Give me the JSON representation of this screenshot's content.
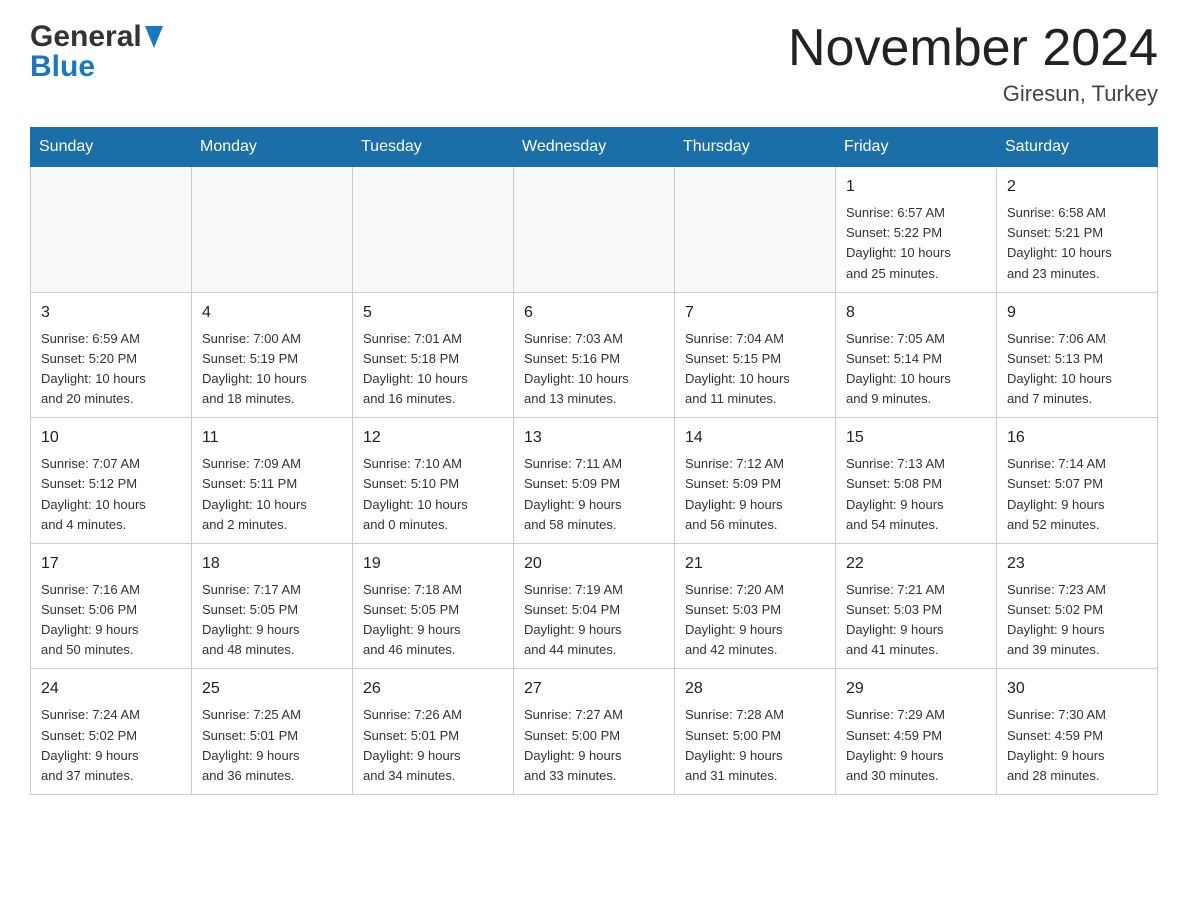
{
  "header": {
    "logo_general": "General",
    "logo_blue": "Blue",
    "month_year": "November 2024",
    "location": "Giresun, Turkey"
  },
  "calendar": {
    "days_of_week": [
      "Sunday",
      "Monday",
      "Tuesday",
      "Wednesday",
      "Thursday",
      "Friday",
      "Saturday"
    ],
    "weeks": [
      {
        "days": [
          {
            "date": "",
            "info": ""
          },
          {
            "date": "",
            "info": ""
          },
          {
            "date": "",
            "info": ""
          },
          {
            "date": "",
            "info": ""
          },
          {
            "date": "",
            "info": ""
          },
          {
            "date": "1",
            "info": "Sunrise: 6:57 AM\nSunset: 5:22 PM\nDaylight: 10 hours\nand 25 minutes."
          },
          {
            "date": "2",
            "info": "Sunrise: 6:58 AM\nSunset: 5:21 PM\nDaylight: 10 hours\nand 23 minutes."
          }
        ]
      },
      {
        "days": [
          {
            "date": "3",
            "info": "Sunrise: 6:59 AM\nSunset: 5:20 PM\nDaylight: 10 hours\nand 20 minutes."
          },
          {
            "date": "4",
            "info": "Sunrise: 7:00 AM\nSunset: 5:19 PM\nDaylight: 10 hours\nand 18 minutes."
          },
          {
            "date": "5",
            "info": "Sunrise: 7:01 AM\nSunset: 5:18 PM\nDaylight: 10 hours\nand 16 minutes."
          },
          {
            "date": "6",
            "info": "Sunrise: 7:03 AM\nSunset: 5:16 PM\nDaylight: 10 hours\nand 13 minutes."
          },
          {
            "date": "7",
            "info": "Sunrise: 7:04 AM\nSunset: 5:15 PM\nDaylight: 10 hours\nand 11 minutes."
          },
          {
            "date": "8",
            "info": "Sunrise: 7:05 AM\nSunset: 5:14 PM\nDaylight: 10 hours\nand 9 minutes."
          },
          {
            "date": "9",
            "info": "Sunrise: 7:06 AM\nSunset: 5:13 PM\nDaylight: 10 hours\nand 7 minutes."
          }
        ]
      },
      {
        "days": [
          {
            "date": "10",
            "info": "Sunrise: 7:07 AM\nSunset: 5:12 PM\nDaylight: 10 hours\nand 4 minutes."
          },
          {
            "date": "11",
            "info": "Sunrise: 7:09 AM\nSunset: 5:11 PM\nDaylight: 10 hours\nand 2 minutes."
          },
          {
            "date": "12",
            "info": "Sunrise: 7:10 AM\nSunset: 5:10 PM\nDaylight: 10 hours\nand 0 minutes."
          },
          {
            "date": "13",
            "info": "Sunrise: 7:11 AM\nSunset: 5:09 PM\nDaylight: 9 hours\nand 58 minutes."
          },
          {
            "date": "14",
            "info": "Sunrise: 7:12 AM\nSunset: 5:09 PM\nDaylight: 9 hours\nand 56 minutes."
          },
          {
            "date": "15",
            "info": "Sunrise: 7:13 AM\nSunset: 5:08 PM\nDaylight: 9 hours\nand 54 minutes."
          },
          {
            "date": "16",
            "info": "Sunrise: 7:14 AM\nSunset: 5:07 PM\nDaylight: 9 hours\nand 52 minutes."
          }
        ]
      },
      {
        "days": [
          {
            "date": "17",
            "info": "Sunrise: 7:16 AM\nSunset: 5:06 PM\nDaylight: 9 hours\nand 50 minutes."
          },
          {
            "date": "18",
            "info": "Sunrise: 7:17 AM\nSunset: 5:05 PM\nDaylight: 9 hours\nand 48 minutes."
          },
          {
            "date": "19",
            "info": "Sunrise: 7:18 AM\nSunset: 5:05 PM\nDaylight: 9 hours\nand 46 minutes."
          },
          {
            "date": "20",
            "info": "Sunrise: 7:19 AM\nSunset: 5:04 PM\nDaylight: 9 hours\nand 44 minutes."
          },
          {
            "date": "21",
            "info": "Sunrise: 7:20 AM\nSunset: 5:03 PM\nDaylight: 9 hours\nand 42 minutes."
          },
          {
            "date": "22",
            "info": "Sunrise: 7:21 AM\nSunset: 5:03 PM\nDaylight: 9 hours\nand 41 minutes."
          },
          {
            "date": "23",
            "info": "Sunrise: 7:23 AM\nSunset: 5:02 PM\nDaylight: 9 hours\nand 39 minutes."
          }
        ]
      },
      {
        "days": [
          {
            "date": "24",
            "info": "Sunrise: 7:24 AM\nSunset: 5:02 PM\nDaylight: 9 hours\nand 37 minutes."
          },
          {
            "date": "25",
            "info": "Sunrise: 7:25 AM\nSunset: 5:01 PM\nDaylight: 9 hours\nand 36 minutes."
          },
          {
            "date": "26",
            "info": "Sunrise: 7:26 AM\nSunset: 5:01 PM\nDaylight: 9 hours\nand 34 minutes."
          },
          {
            "date": "27",
            "info": "Sunrise: 7:27 AM\nSunset: 5:00 PM\nDaylight: 9 hours\nand 33 minutes."
          },
          {
            "date": "28",
            "info": "Sunrise: 7:28 AM\nSunset: 5:00 PM\nDaylight: 9 hours\nand 31 minutes."
          },
          {
            "date": "29",
            "info": "Sunrise: 7:29 AM\nSunset: 4:59 PM\nDaylight: 9 hours\nand 30 minutes."
          },
          {
            "date": "30",
            "info": "Sunrise: 7:30 AM\nSunset: 4:59 PM\nDaylight: 9 hours\nand 28 minutes."
          }
        ]
      }
    ]
  }
}
